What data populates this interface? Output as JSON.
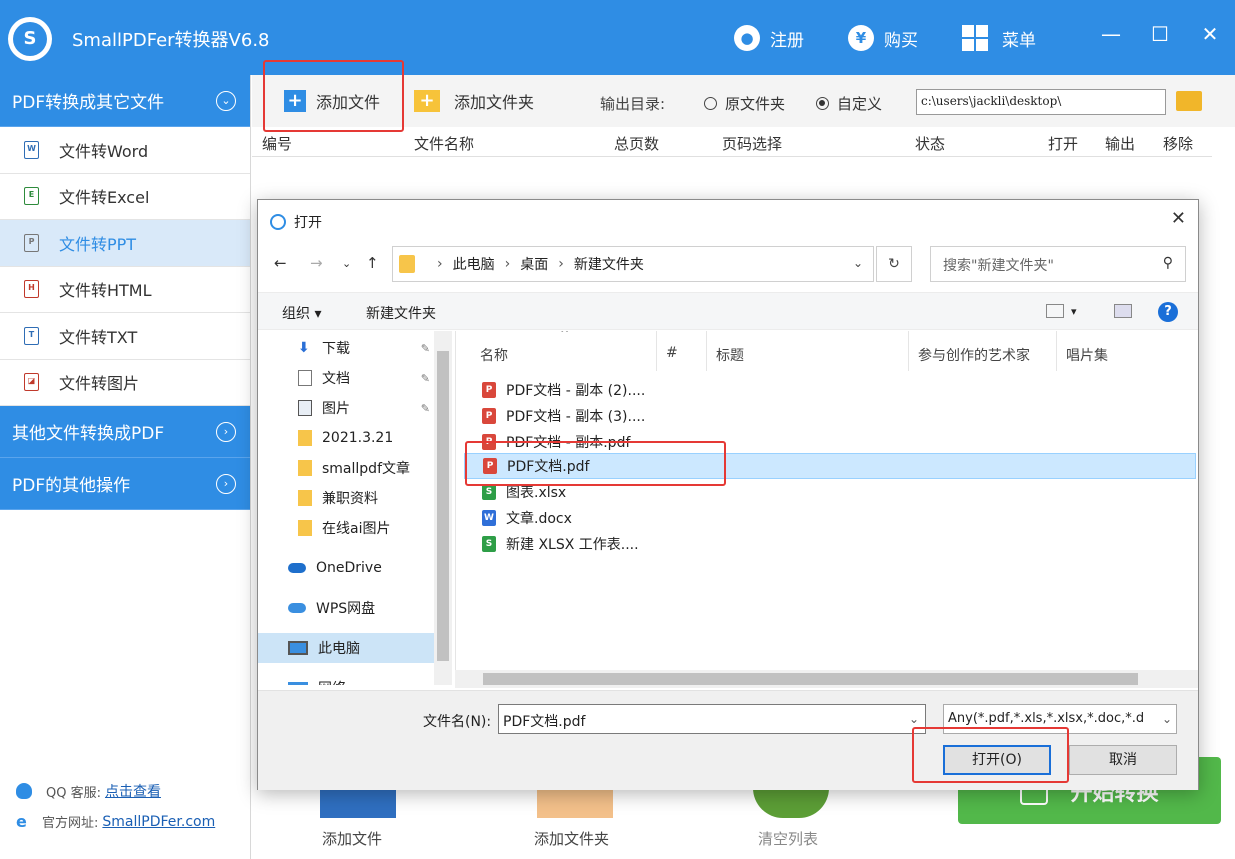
{
  "app": {
    "title": "SmallPDFer转换器V6.8",
    "logo_letter": "S",
    "register_label": "注册",
    "buy_label": "购买",
    "menu_label": "菜单",
    "brand_color": "#2f8de4"
  },
  "sidebar": {
    "section1_title": "PDF转换成其它文件",
    "items": [
      {
        "label": "文件转Word",
        "icon": "W"
      },
      {
        "label": "文件转Excel",
        "icon": "E"
      },
      {
        "label": "文件转PPT",
        "icon": "P"
      },
      {
        "label": "文件转HTML",
        "icon": "H"
      },
      {
        "label": "文件转TXT",
        "icon": "T"
      },
      {
        "label": "文件转图片",
        "icon": "image-icon"
      }
    ],
    "section2_title": "其他文件转换成PDF",
    "section3_title": "PDF的其他操作",
    "qq_label": "QQ 客服:",
    "qq_link": "点击查看",
    "site_label": "官方网址:",
    "site_link": "SmallPDFer.com"
  },
  "toolbar": {
    "add_file": "添加文件",
    "add_folder": "添加文件夹",
    "output_dir_label": "输出目录:",
    "radio_original": "原文件夹",
    "radio_custom": "自定义",
    "output_path": "c:\\users\\jackli\\desktop\\"
  },
  "table": {
    "headers": [
      "编号",
      "文件名称",
      "总页数",
      "页码选择",
      "状态",
      "打开",
      "输出",
      "移除"
    ]
  },
  "bottom": {
    "add_file": "添加文件",
    "add_folder": "添加文件夹",
    "clear_list": "清空列表",
    "start": "开始转换"
  },
  "dialog": {
    "title": "打开",
    "breadcrumb": [
      "此电脑",
      "桌面",
      "新建文件夹"
    ],
    "search_placeholder": "搜索\"新建文件夹\"",
    "organize": "组织 ▾",
    "new_folder": "新建文件夹",
    "nav_items": [
      {
        "label": "下载",
        "icon": "download-icon",
        "pinned": true
      },
      {
        "label": "文档",
        "icon": "document-icon",
        "pinned": true
      },
      {
        "label": "图片",
        "icon": "picture-icon",
        "pinned": true
      },
      {
        "label": "2021.3.21",
        "icon": "folder-icon",
        "pinned": false
      },
      {
        "label": "smallpdf文章",
        "icon": "folder-icon",
        "pinned": false
      },
      {
        "label": "兼职资料",
        "icon": "folder-icon",
        "pinned": false
      },
      {
        "label": "在线ai图片",
        "icon": "folder-icon",
        "pinned": false
      },
      {
        "label": "OneDrive",
        "icon": "cloud-icon",
        "pinned": false
      },
      {
        "label": "WPS网盘",
        "icon": "cloud-icon",
        "pinned": false
      },
      {
        "label": "此电脑",
        "icon": "computer-icon",
        "pinned": false
      },
      {
        "label": "网络",
        "icon": "network-icon",
        "pinned": false
      }
    ],
    "columns": [
      "名称",
      "#",
      "标题",
      "参与创作的艺术家",
      "唱片集"
    ],
    "files": [
      {
        "name": "PDF文档 - 副本 (2)....",
        "type": "pdf"
      },
      {
        "name": "PDF文档 - 副本 (3)....",
        "type": "pdf"
      },
      {
        "name": "PDF文档 - 副本.pdf",
        "type": "pdf"
      },
      {
        "name": "PDF文档.pdf",
        "type": "pdf"
      },
      {
        "name": "图表.xlsx",
        "type": "xlsx"
      },
      {
        "name": "文章.docx",
        "type": "docx"
      },
      {
        "name": "新建 XLSX 工作表....",
        "type": "xlsx"
      }
    ],
    "selected_file": "PDF文档.pdf",
    "filename_label": "文件名(N):",
    "filename_value": "PDF文档.pdf",
    "filetype": "Any(*.pdf,*.xls,*.xlsx,*.doc,*.d",
    "open_button": "打开(O)",
    "cancel_button": "取消"
  },
  "colors": {
    "highlight_red": "#e53935",
    "start_green": "#52b84a"
  }
}
